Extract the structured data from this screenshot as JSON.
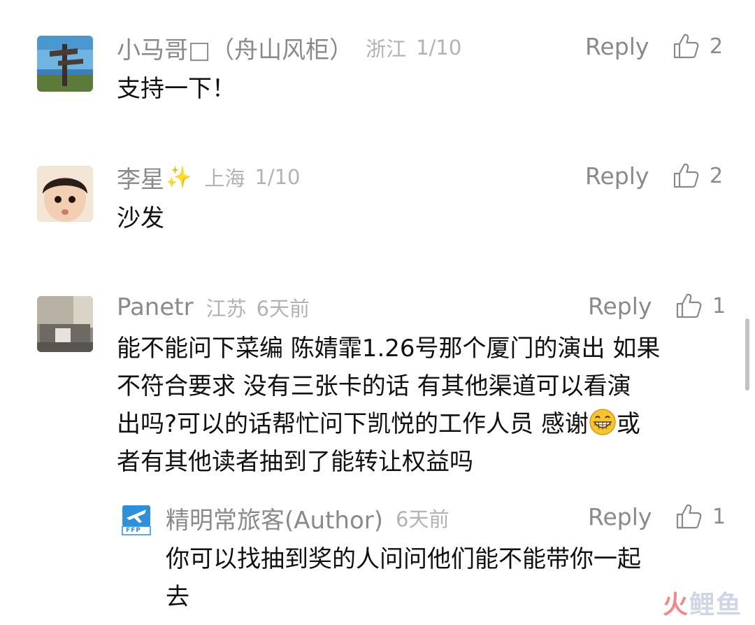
{
  "comments": [
    {
      "author": "小马哥□（舟山风柜）",
      "region": "浙江",
      "date": "1/10",
      "reply_label": "Reply",
      "likes": "2",
      "text_lines": [
        "支持一下！"
      ]
    },
    {
      "author": "李星",
      "region": "上海",
      "date": "1/10",
      "reply_label": "Reply",
      "likes": "2",
      "text_lines": [
        "沙发"
      ]
    },
    {
      "author": "Panetr",
      "region": "江苏",
      "date": "6天前",
      "reply_label": "Reply",
      "likes": "1",
      "text_lines": [
        "能不能问下菜编 陈婧霏1.26号那个厦门的演出 如果",
        "不符合要求 没有三张卡的话 有其他渠道可以看演",
        "出吗?可以的话帮忙问下凯悦的工作人员 感谢",
        "或",
        "者有其他读者抽到了能转让权益吗"
      ],
      "reply": {
        "author": "精明常旅客(Author)",
        "date": "6天前",
        "reply_label": "Reply",
        "likes": "1",
        "avatar_text": "FFP",
        "text_lines": [
          "你可以找抽到奖的人问问他们能不能带你一起",
          "去"
        ]
      }
    }
  ],
  "watermark": {
    "part1": "火",
    "part2": "鲤鱼"
  },
  "colors": {
    "meta_gray": "#8a8a8a",
    "light_gray": "#b3b3b3",
    "text_black": "#111111",
    "ffp_blue": "#2f8fd8"
  },
  "icons": {
    "like": "thumbs-up-icon",
    "emoji": "grin-emoji-icon",
    "sparkle": "sparkles-icon"
  }
}
